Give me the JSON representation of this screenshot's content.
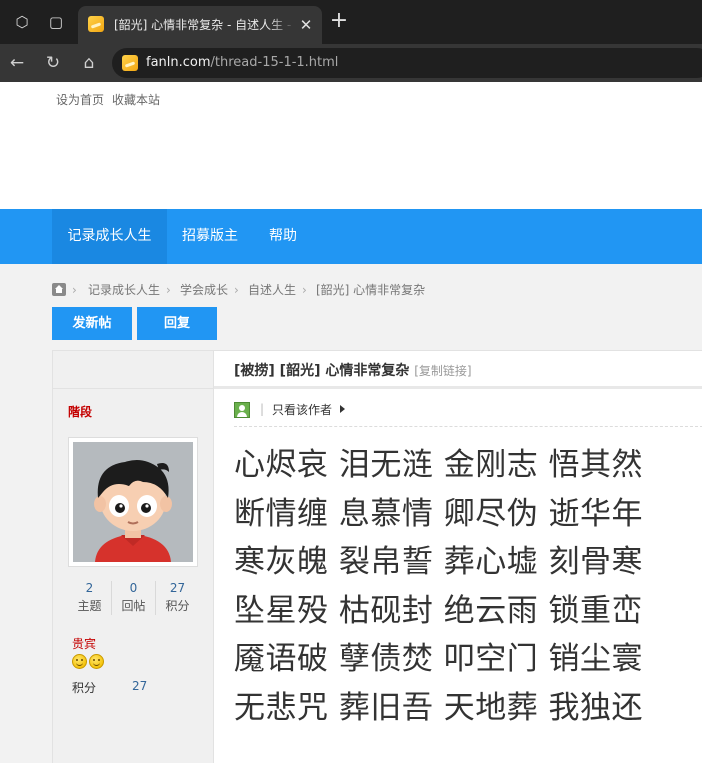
{
  "browser": {
    "tab_title": "[韶光] 心情非常复杂 - 自述人生 - 记录成长人生",
    "tab_close": "✕",
    "new_tab": "+",
    "url_host": "fanln.com",
    "url_path": "/thread-15-1-1.html",
    "icons": [
      "workspaces-icon",
      "tab-actions-icon",
      "back-icon",
      "reload-icon",
      "home-icon",
      "site-favicon"
    ]
  },
  "topbar": {
    "set_home": "设为首页",
    "bookmark": "收藏本站"
  },
  "nav": {
    "items": [
      "记录成长人生",
      "招募版主",
      "帮助"
    ],
    "active_index": 0,
    "color": "#2196f3"
  },
  "breadcrumb": {
    "items": [
      "记录成长人生",
      "学会成长",
      "自述人生",
      "[韶光] 心情非常复杂"
    ],
    "separator": "›"
  },
  "actions": {
    "new_post": "发新帖",
    "reply": "回复"
  },
  "user": {
    "rank_label": "階段",
    "stats": [
      {
        "value": "2",
        "label": "主题"
      },
      {
        "value": "0",
        "label": "回帖"
      },
      {
        "value": "27",
        "label": "积分"
      }
    ],
    "group": "贵宾",
    "points_label": "积分",
    "points_value": "27"
  },
  "thread": {
    "title": "[被捞] [韶光] 心情非常复杂",
    "copy_link": "[复制链接]",
    "only_author": "只看该作者",
    "content_lines": [
      "心烬哀 泪无涟 金刚志 悟其然",
      "断情缠 息慕情 卿尽伪 逝华年",
      "寒灰魄 裂帛誓 葬心墟 刻骨寒",
      "坠星殁 枯砚封 绝云雨 锁重峦",
      "魇语破 孽债焚 叩空门 销尘寰",
      "无悲咒 葬旧吾 天地葬 我独还"
    ]
  }
}
